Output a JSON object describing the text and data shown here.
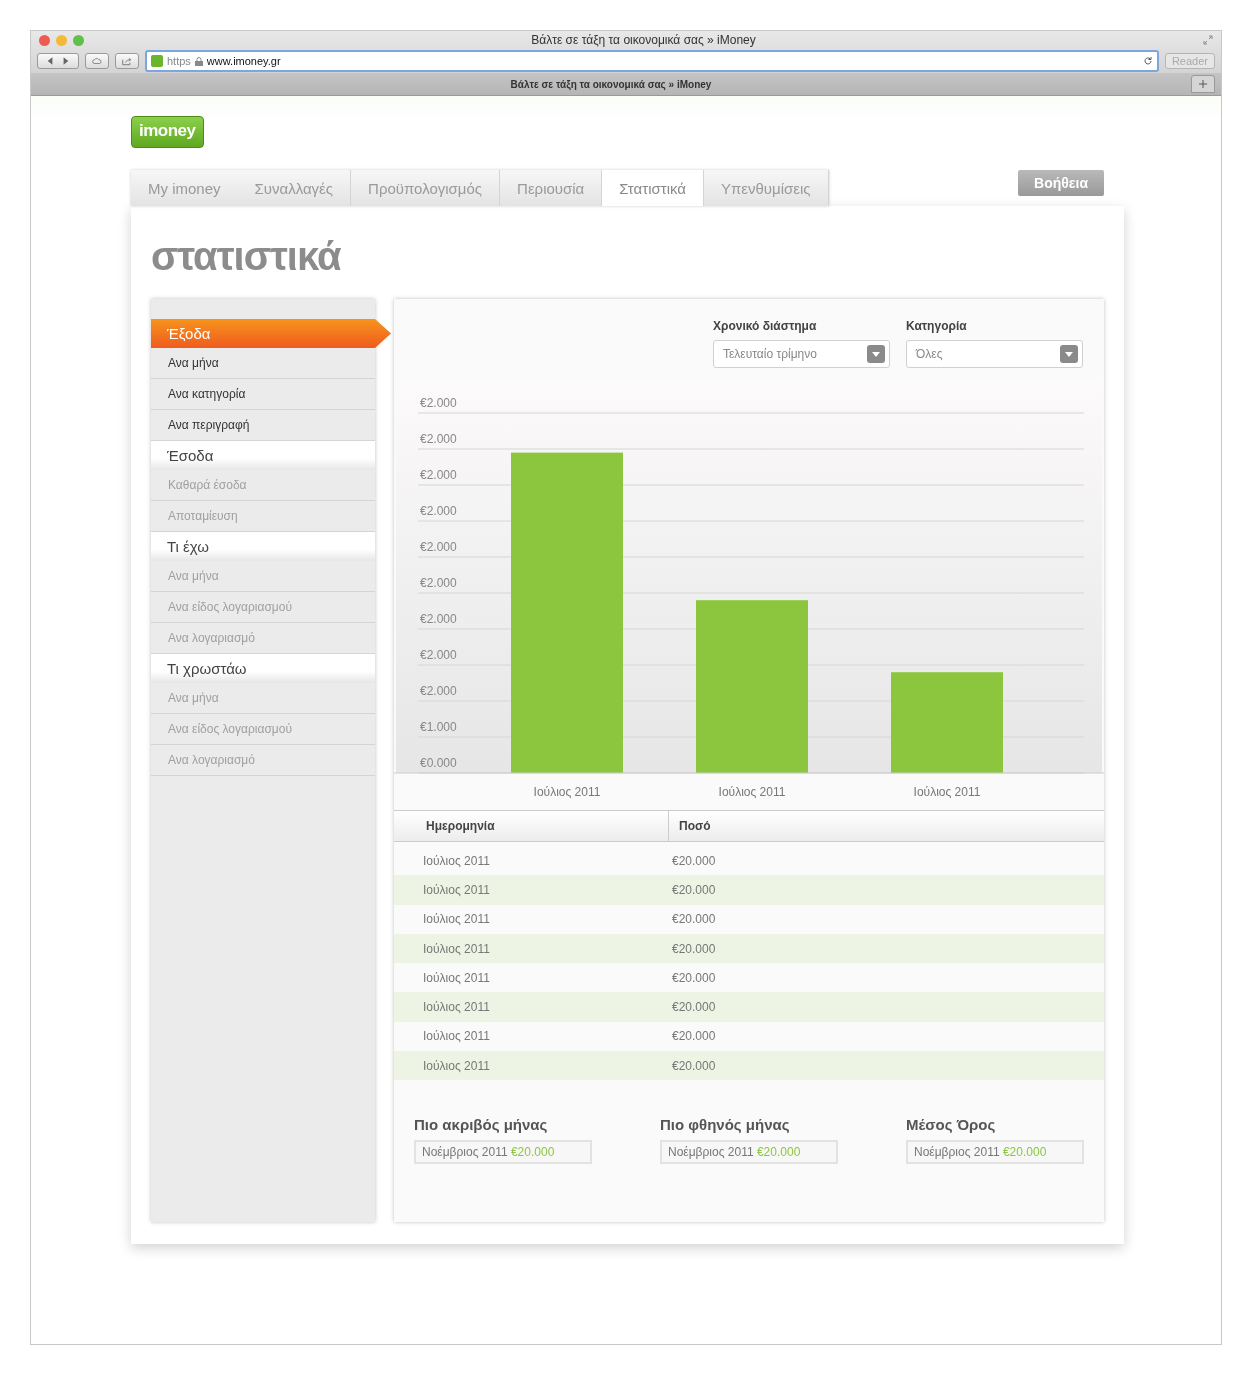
{
  "browser": {
    "title": "Βάλτε σε τάξη τα οικονομικά σας » iMoney",
    "scheme": "https",
    "url": "www.imoney.gr",
    "reader": "Reader",
    "tab_title": "Βάλτε σε τάξη τα οικονομικά σας » iMoney"
  },
  "logo": "imoney",
  "nav": [
    {
      "label": "My imoney",
      "selected": false
    },
    {
      "label": "Συναλλαγές",
      "selected": false
    },
    {
      "label": "Προϋπολογισμός",
      "selected": false
    },
    {
      "label": "Περιουσία",
      "selected": false
    },
    {
      "label": "Στατιστικά",
      "selected": true
    },
    {
      "label": "Υπενθυμίσεις",
      "selected": false
    }
  ],
  "help_button": "Βοήθεια",
  "heading": "στατιστικά",
  "sidebar": [
    {
      "title": "Έξοδα",
      "selected": true,
      "items": [
        "Ανα μήνα",
        "Ανα κατηγορία",
        "Ανα περιγραφή"
      ]
    },
    {
      "title": "Έσοδα",
      "selected": false,
      "items": [
        "Καθαρά έσοδα",
        "Αποταμίευση"
      ]
    },
    {
      "title": "Τι έχω",
      "selected": false,
      "items": [
        "Ανα μήνα",
        "Ανα είδος λογαριασμού",
        "Ανα λογαριασμό"
      ]
    },
    {
      "title": "Τι χρωστάω",
      "selected": false,
      "items": [
        "Ανα μήνα",
        "Ανα είδος λογαριασμού",
        "Ανα λογαριασμό"
      ]
    }
  ],
  "filters": [
    {
      "label": "Χρονικό διάστημα",
      "value": "Τελευταίο τρίμηνο"
    },
    {
      "label": "Κατηγορία",
      "value": "Όλες"
    }
  ],
  "chart": {
    "y_labels": [
      "€2.000",
      "€2.000",
      "€2.000",
      "€2.000",
      "€2.000",
      "€2.000",
      "€2.000",
      "€2.000",
      "€2.000",
      "€1.000",
      "€0.000"
    ],
    "x_labels": [
      "Ιούλιος 2011",
      "Ιούλιος 2011",
      "Ιούλιος 2011"
    ]
  },
  "table": {
    "columns": [
      "Ημερομηνία",
      "Ποσό"
    ],
    "rows": [
      [
        "Ιούλιος 2011",
        "€20.000"
      ],
      [
        "Ιούλιος 2011",
        "€20.000"
      ],
      [
        "Ιούλιος 2011",
        "€20.000"
      ],
      [
        "Ιούλιος 2011",
        "€20.000"
      ],
      [
        "Ιούλιος 2011",
        "€20.000"
      ],
      [
        "Ιούλιος 2011",
        "€20.000"
      ],
      [
        "Ιούλιος 2011",
        "€20.000"
      ],
      [
        "Ιούλιος 2011",
        "€20.000"
      ]
    ]
  },
  "summary": [
    {
      "title": "Πιο ακριβός μήνας",
      "date": "Νοέμβριος 2011",
      "amount": "€20.000"
    },
    {
      "title": "Πιο φθηνός μήνας",
      "date": "Νοέμβριος 2011",
      "amount": "€20.000"
    },
    {
      "title": "Μέσος Όρος",
      "date": "Νοέμβριος 2011",
      "amount": "€20.000"
    }
  ]
}
